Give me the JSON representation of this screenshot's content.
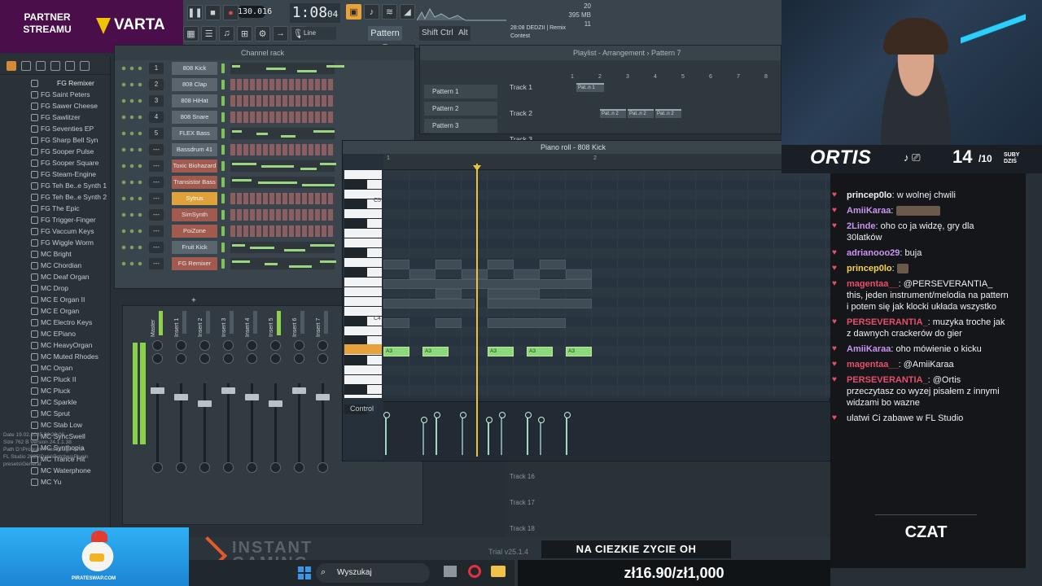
{
  "partner": {
    "line1": "PARTNER",
    "line2": "STREAMU",
    "brand": "VARTA"
  },
  "transport": {
    "tempo": "130.016",
    "time": "1:08",
    "time_small": "04",
    "pattern": "Pattern 7",
    "snap": "Line",
    "mod_keys": [
      "Shift",
      "Ctrl",
      "Alt"
    ],
    "cpu": "20",
    "mem": "395 MB",
    "poly": "11"
  },
  "song_info": {
    "line1": "28:08 DEDZII | Remix",
    "line2": "Contest"
  },
  "browser": {
    "title": "FG Remixer",
    "items": [
      "FG Saint Peters",
      "FG Sawer Cheese",
      "FG Sawlitzer",
      "FG Seventies EP",
      "FG Sharp Bell Syn",
      "FG Sooper Pulse",
      "FG Sooper Square",
      "FG Steam-Engine",
      "FG Teh Be..e Synth 1",
      "FG Teh Be..e Synth 2",
      "FG The Epic",
      "FG Trigger-Finger",
      "FG Vaccum Keys",
      "FG Wiggle Worm",
      "MC Bright",
      "MC Chordian",
      "MC Deaf Organ",
      "MC Drop",
      "MC E Organ II",
      "MC E Organ",
      "MC Electro Keys",
      "MC EPiano",
      "MC HeavyOrgan",
      "MC Muted Rhodes",
      "MC Organ",
      "MC Pluck II",
      "MC Pluck",
      "MC Sparkle",
      "MC Sprut",
      "MC Stab Low",
      "MC SyncSwell",
      "MC Synthopia",
      "MC Trance Hit",
      "MC Waterphone",
      "MC Yu"
    ],
    "info": [
      "Date     19.02.2025 09:29:06",
      "Size     762 B        Version 24.1.1.38",
      "Path     D:\\Program Files\\Image-Line\\",
      "FL Studio 2025\\Data\\Patches\\Plugin presets\\Generat"
    ]
  },
  "channel_rack": {
    "title": "Channel rack",
    "channels": [
      {
        "num": "1",
        "name": "808 Kick",
        "style": "roll"
      },
      {
        "num": "2",
        "name": "808 Clap",
        "style": "steps"
      },
      {
        "num": "3",
        "name": "808 HiHat",
        "style": "steps"
      },
      {
        "num": "4",
        "name": "808 Snare",
        "style": "steps"
      },
      {
        "num": "5",
        "name": "FLEX Bass",
        "style": "roll"
      },
      {
        "num": "---",
        "name": "Bassdrum 41",
        "style": "steps"
      },
      {
        "num": "---",
        "name": "Toxic Biohazard",
        "style": "roll",
        "color": "red"
      },
      {
        "num": "---",
        "name": "Transistor Bass",
        "style": "roll",
        "color": "red"
      },
      {
        "num": "---",
        "name": "Sytrus",
        "style": "steps",
        "color": "sel"
      },
      {
        "num": "---",
        "name": "SimSynth",
        "style": "steps",
        "color": "red"
      },
      {
        "num": "---",
        "name": "PoiZone",
        "style": "steps",
        "color": "red"
      },
      {
        "num": "---",
        "name": "Fruit Kick",
        "style": "roll"
      },
      {
        "num": "---",
        "name": "FG Remixer",
        "style": "roll",
        "color": "red"
      }
    ],
    "add": "+"
  },
  "mixer": {
    "strips": [
      "Master",
      "Insert 1",
      "Insert 2",
      "Insert 3",
      "Insert 4",
      "Insert 5",
      "Insert 6",
      "Insert 7"
    ]
  },
  "playlist": {
    "title": "Playlist - Arrangement › Pattern 7",
    "patterns": [
      "Pattern 1",
      "Pattern 2",
      "Pattern 3"
    ],
    "tracks": [
      "Track 1",
      "Track 2",
      "Track 3"
    ],
    "bottom_tracks": [
      "Track 16",
      "Track 17",
      "Track 18"
    ],
    "clip_label": "Pat..n 2",
    "clip_label_1": "Pat..n 1",
    "ruler": [
      "1",
      "2",
      "3",
      "4",
      "5",
      "6",
      "7",
      "8"
    ]
  },
  "piano_roll": {
    "title": "Piano roll - 808 Kick",
    "key_c5": "C5",
    "key_c4": "C4",
    "note_label": "A3",
    "control": "Control",
    "ruler": [
      "1",
      "2",
      "3"
    ]
  },
  "stream": {
    "name": "ORTIS",
    "subs": "14",
    "subs_goal": "/10",
    "subs_label1": "SUBY",
    "subs_label2": "DZIŚ",
    "chat_label": "CZAT",
    "ticker": "NA CIEZKIE ZYCIE OH",
    "donation": "zł16.90/zł1,000",
    "sponsor": "INSTANT GAMING",
    "pirate": "PIRATESWAP.COM",
    "trial": "Trial v25.1.4"
  },
  "chat": [
    {
      "user": "princep0lo",
      "text": "w wolnej chwili",
      "color": "#f0f0f0"
    },
    {
      "user": "AmiiKaraa",
      "text": "",
      "color": "#c995f2",
      "emote": true
    },
    {
      "user": "2Linde",
      "text": "oho co ja widzę, gry dla 30latków",
      "color": "#c995f2"
    },
    {
      "user": "adrianooo29",
      "text": "buja",
      "color": "#c995f2"
    },
    {
      "user": "princep0lo",
      "text": "",
      "color": "#f5d54a",
      "emote": true
    },
    {
      "user": "magentaa__",
      "text": "@PERSEVERANTIA_ this, jeden instrument/melodia na pattern i potem się jak klocki układa wszystko",
      "color": "#e84e6a"
    },
    {
      "user": "PERSEVERANTIA_",
      "text": "muzyka troche jak z dawnych crackerów do gier",
      "color": "#e84e6a"
    },
    {
      "user": "AmiiKaraa",
      "text": "oho mówienie o kicku",
      "color": "#c995f2"
    },
    {
      "user": "magentaa__",
      "text": "@AmiiKaraa",
      "color": "#e84e6a"
    },
    {
      "user": "PERSEVERANTIA_",
      "text": "@Ortis przeczytasz co wyzej pisałem z innymi widzami bo wazne",
      "color": "#e84e6a"
    },
    {
      "user": "",
      "text": "ulatwi Ci zabawe w FL Studio",
      "color": "#e84e6a"
    }
  ],
  "taskbar": {
    "search": "Wyszukaj"
  }
}
